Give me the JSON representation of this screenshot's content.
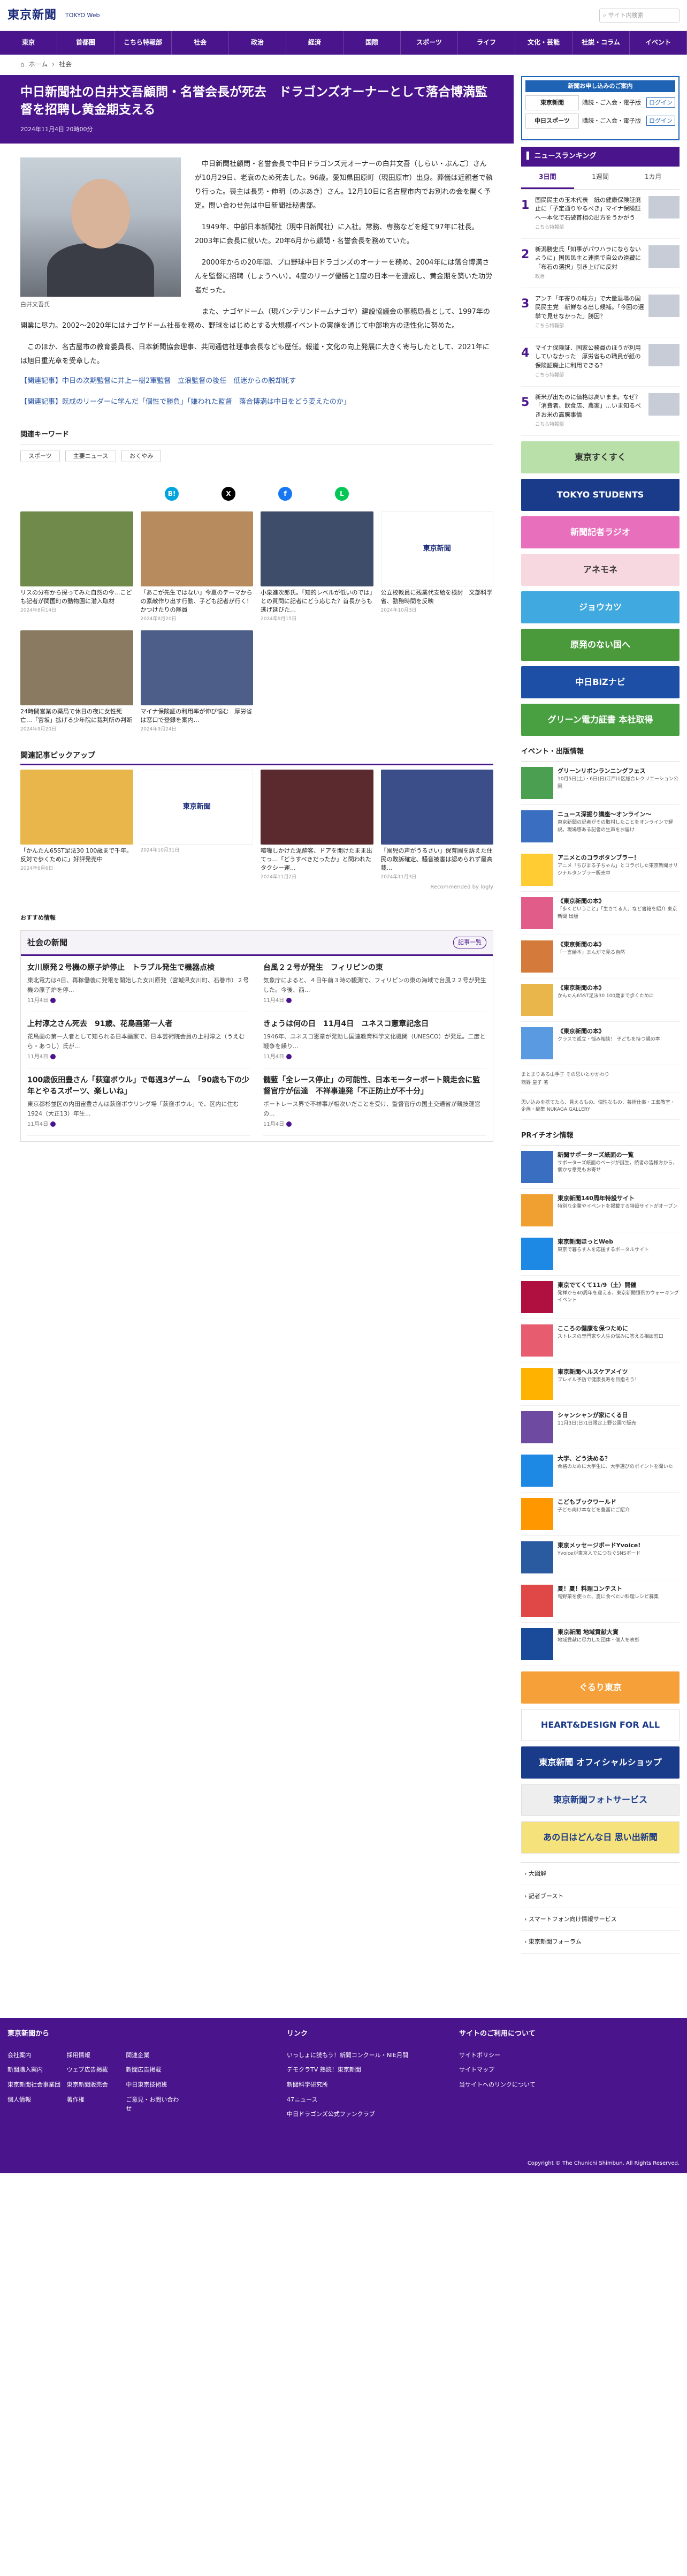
{
  "site": {
    "logo": "東京新聞",
    "logo_sub": "TOKYO Web",
    "search_placeholder": "サイト内検索"
  },
  "nav": [
    "東京",
    "首都圏",
    "こちら特報部",
    "社会",
    "政治",
    "経済",
    "国際",
    "スポーツ",
    "ライフ",
    "文化・芸能",
    "社説・コラム",
    "イベント"
  ],
  "breadcrumb": [
    "ホーム",
    "社会"
  ],
  "article": {
    "title": "中日新聞社の白井文吾顧問・名誉会長が死去　ドラゴンズオーナーとして落合博満監督を招聘し黄金期支える",
    "date": "2024年11月4日 20時00分",
    "caption": "白井文吾氏",
    "paragraphs": [
      "中日新聞社顧問・名誉会長で中日ドラゴンズ元オーナーの白井文吾（しらい・ぶんご）さんが10月29日、老衰のため死去した。96歳。愛知県田原町（現田原市）出身。葬儀は近親者で執り行った。喪主は長男・伸明（のぶあき）さん。12月10日に名古屋市内でお別れの会を開く予定。問い合わせ先は中日新聞社秘書部。",
      "1949年、中部日本新聞社（現中日新聞社）に入社。常務、専務などを経て97年に社長。2003年に会長に就いた。20年6月から顧問・名誉会長を務めていた。",
      "2000年からの20年間、プロ野球中日ドラゴンズのオーナーを務め、2004年には落合博満さんを監督に招聘（しょうへい）。4度のリーグ優勝と1度の日本一を達成し、黄金期を築いた功労者だった。",
      "また、ナゴヤドーム（現バンテリンドームナゴヤ）建設協議会の事務局長として、1997年の開業に尽力。2002〜2020年にはナゴヤドーム社長を務め、野球をはじめとする大規模イベントの実施を通じて中部地方の活性化に努めた。",
      "このほか、名古屋市の教育委員長、日本新聞協会理事、共同通信社理事会長なども歴任。報道・文化の向上発展に大きく寄与したとして、2021年には旭日重光章を受章した。"
    ],
    "related": [
      "【関連記事】中日の次期監督に井上一樹2軍監督　立浪監督の後任　低迷からの脱却託す",
      "【関連記事】既成のリーダーに学んだ「個性で勝負」「嫌われた監督　落合博満は中日をどう変えたのか」"
    ]
  },
  "keywords": {
    "title": "関連キーワード",
    "items": [
      "スポーツ",
      "主要ニュース",
      "おくやみ"
    ]
  },
  "share": [
    {
      "icon": "hatena-icon",
      "label": "B!",
      "color": "#00a4de"
    },
    {
      "icon": "x-icon",
      "label": "X",
      "color": "#000000"
    },
    {
      "icon": "facebook-icon",
      "label": "f",
      "color": "#1877f2"
    },
    {
      "icon": "line-icon",
      "label": "L",
      "color": "#06c755"
    }
  ],
  "cards": [
    {
      "title": "リスの分布から探ってみた自然の今…こども記者が関国町の動物園に潜入取材",
      "date": "2024年8月14日",
      "color": "#6f8a4a"
    },
    {
      "title": "「あこが先生ではない」今夏のテーマからの素敵作り出す行動、子ども記者が行く！かつけたりの隊員",
      "date": "2024年8月20日",
      "color": "#b78b5d"
    },
    {
      "title": "小泉進次郎氏。「知的レベルが低いのでは」との質問に記者にどう応じた？首長からも逃げ延びた…",
      "date": "2024年9月15日",
      "color": "#3e4e6a"
    },
    {
      "title": "公立校教員に残業代支給を検討　文部科学省、勤務時間を反映",
      "date": "2024年10月3日",
      "color": "#ffffff"
    },
    {
      "title": "24時間営業の薬局で休日の夜に女性死亡…「宮坂」拡げる少年院に裁判所の判断",
      "date": "2024年9月20日",
      "color": "#8a7a62"
    },
    {
      "title": "マイナ保険証の利用率が伸び悩む　厚労省は窓口で登録を案内…",
      "date": "2024年9月24日",
      "color": "#4d5f88"
    }
  ],
  "pickup": {
    "title": "関連記事ピックアップ",
    "items": [
      {
        "title": "「かんたん65ST足法30 100歳まで千年。反対で歩くために」好評発売中",
        "date": "2024年6月6日",
        "color": "#e8b64a"
      },
      {
        "title": "",
        "date": "2024年10月31日",
        "color": "#ffffff"
      },
      {
        "title": "喧嘩しかけた泥酔客、ドアを開けたまま出てっ…「どうすべきだったか」と問われたタクシー運...",
        "date": "2024年11月2日",
        "color": "#5a2a2e"
      },
      {
        "title": "「園児の声がうるさい」保育園を訴えた住民の敗訴確定、騒音被害は認められず最高裁...",
        "date": "2024年11月3日",
        "color": "#3c4e8a"
      }
    ],
    "rec": "Recommended by logly"
  },
  "osusume": "おすすめ情報",
  "society": {
    "title": "社会の新聞",
    "more": "記事一覧",
    "items": [
      {
        "title": "女川原発２号機の原子炉停止　トラブル発生で機器点検",
        "summary": "東北電力は4日、再稼働後に発電を開始した女川原発（宮城県女川町、石巻市）２号機の原子炉を停...",
        "date": "11月4日"
      },
      {
        "title": "台風２２号が発生　フィリピンの東",
        "summary": "気象庁によると、４日午前３時の観測で、フィリピンの東の海域で台風２２号が発生した。今後、西...",
        "date": "11月4日"
      },
      {
        "title": "上村淳之さん死去　91歳、花鳥画第一人者",
        "summary": "花鳥画の第一人者として知られる日本画家で、日本芸術院会員の上村淳之（うえむら・あつし）氏が...",
        "date": "11月4日"
      },
      {
        "title": "きょうは何の日　11月4日　ユネスコ憲章記念日",
        "summary": "1946年、ユネスコ憲章が発効し国連教育科学文化機関（UNESCO）が発足。二度と戦争を繰り...",
        "date": "11月4日"
      },
      {
        "title": "100歳仮田豊さん「荻窪ボウル」で毎週3ゲーム　「90歳も下の少年とやるスポーツ、楽しいね」",
        "summary": "東京都杉並区の内田宙豊さんは荻窪ボウリング場「荻窪ボウル」で、区内に住む1924（大正13）年生...",
        "date": "11月4日"
      },
      {
        "title": "髄藍「全レース停止」の可能性、日本モーターボート競走会に監督官庁が伝達　不祥事連発「不正防止が不十分」",
        "summary": "ボートレース界で不祥事が相次いだことを受け、監督官庁の国土交通省が競技運営の...",
        "date": "11月4日"
      }
    ]
  },
  "side": {
    "promo": {
      "title": "新聞お申し込みのご案内",
      "rows": [
        {
          "logo": "東京新聞",
          "items": "購読・ご入会・電子版",
          "btn": "ログイン"
        },
        {
          "logo": "中日スポーツ",
          "items": "購読・ご入会・電子版",
          "btn": "ログイン"
        }
      ]
    },
    "ranking": {
      "title": "ニュースランキング",
      "tabs": [
        "3日間",
        "1週間",
        "1カ月"
      ],
      "items": [
        {
          "num": "1",
          "title": "国民民主の玉木代表　紙の健康保険証廃止に「予定通りやるべき」マイナ保険証へ一本化で石破首相の出方をうかがう",
          "src": "こちら特報部"
        },
        {
          "num": "2",
          "title": "新潟勝史氏「知事がパワハラにならないように」国民民主と連携で自公の遠藏に「布石の選択」引き上げに反対",
          "src": "政治"
        },
        {
          "num": "3",
          "title": "アンチ「年寄りの味方」で大量退場の国民民主党　新鮮なる出し候補。「今回の選挙で見せなかった」勝因？",
          "src": "こちら特報部"
        },
        {
          "num": "4",
          "title": "マイナ保険証、国家公務員のほうが利用していなかった　厚労省もの職員が紙の保険証廃止に利用できる？",
          "src": "こちら特報部"
        },
        {
          "num": "5",
          "title": "新米が出たのに価格は高いまま。なぜ？「消費者、飲食店、農家」…いま知るべきお米の高騰事情",
          "src": "こちら特報部"
        }
      ]
    },
    "banners": [
      {
        "label": "東京すくすく",
        "color": "#b8e0a8"
      },
      {
        "label": "TOKYO STUDENTS",
        "color": "#1a3a8a"
      },
      {
        "label": "新聞記者ラジオ",
        "color": "#e86fbc"
      },
      {
        "label": "アネモネ",
        "color": "#f7d8e0"
      },
      {
        "label": "ジョウカツ",
        "color": "#3fa9e0"
      },
      {
        "label": "原発のない国へ",
        "color": "#4a9a3c"
      },
      {
        "label": "中日BiZナビ",
        "color": "#1d4fa6"
      },
      {
        "label": "グリーン電力証書 本社取得",
        "color": "#48a040"
      }
    ],
    "events": {
      "title": "イベント・出版情報",
      "items": [
        {
          "title": "グリーンリボンランニングフェス",
          "summary": "10月5日(土)・6日(日)江戸川区総合レクリエーション公園",
          "color": "#4aa050"
        },
        {
          "title": "ニュース深掘り講座〜オンライン〜",
          "summary": "東京新聞の記者がその取材したことをオンラインで解説。現場感ある記者の生声をお届け",
          "color": "#3a6ec0"
        },
        {
          "title": "アニメとのコラボタンブラー！",
          "summary": "アニメ「ちびまる子ちゃん」とコラボした東京新聞オリジナルタンブラー販売中",
          "color": "#ffcc33"
        },
        {
          "title": "《東京新聞の本》",
          "summary": "「歩くということ」「生きてる人」など書籍を紹介 東京新聞 出版",
          "color": "#e25c8a"
        },
        {
          "title": "《東京新聞の本》",
          "summary": "「一言絵本」まんがで見る自然",
          "color": "#d47a3a"
        },
        {
          "title": "《東京新聞の本》",
          "summary": "かんたん65ST足法30 100歳まで歩くために",
          "color": "#e8b64a"
        },
        {
          "title": "《東京新聞の本》",
          "summary": "クラスで孤立・悩み相談！ 子どもを持つ親の本",
          "color": "#5a9ae0"
        }
      ]
    },
    "misc": [
      "まとまりある山手子 その思いとかかわり",
      "西野 皇子 著",
      "思い込みを捨てたら、見えるもの。個性なもの、芸術仕事・工藝教室・企画・編集 NUKAGA GALLERY"
    ],
    "pr": {
      "title": "PRイチオシ情報",
      "items": [
        {
          "title": "新聞サポーターズ紙面の一覧",
          "summary": "サポーターズ紙面のページが誕生。読者の皆様方から、個かな意見もお寄せ",
          "color": "#3a6ec0"
        },
        {
          "title": "東京新聞140周年特設サイト",
          "summary": "特別な企業やイベントを掲載する特設サイトがオープン",
          "color": "#f0a030"
        },
        {
          "title": "東京新聞ほっとWeb",
          "summary": "東京で暮らす人を応援するポータルサイト",
          "color": "#1e88e5"
        },
        {
          "title": "東京でてくて11/9（土）開催",
          "summary": "発祥から40周年を迎える、東京新聞恒例のウォーキングイベント",
          "color": "#b01040"
        },
        {
          "title": "こころの健康を保つために",
          "summary": "ストレスの専門家や人生の悩みに答える相談窓口",
          "color": "#e85c70"
        },
        {
          "title": "東京新聞ヘルスケアメイツ",
          "summary": "プレイル予防で健康長寿を目指そう！",
          "color": "#ffb300"
        },
        {
          "title": "シャンシャンが家にくる日",
          "summary": "11月3日(日)1日限定上野公園で販売",
          "color": "#6e4aa0"
        },
        {
          "title": "大学、どう決める？",
          "summary": "合格のために大学生に、大学選びのポイントを聞いた",
          "color": "#1e88e5"
        },
        {
          "title": "こどもブックワールド",
          "summary": "子ども向け本などを豊富にご紹介",
          "color": "#ff9800"
        },
        {
          "title": "東京メッセージボードYvoice!",
          "summary": "Yvoiceが東京人でにつなぐSNSボード",
          "color": "#2a5aa0"
        },
        {
          "title": "夏！夏！料理コンテスト",
          "summary": "旬野菜を使った、夏に食べたい料理レシピ募集",
          "color": "#e04848"
        },
        {
          "title": "東京新聞 地域貢献大賞",
          "summary": "地域貢献に尽力した団体・個人を表彰",
          "color": "#1a4a9a"
        }
      ]
    },
    "banners2": [
      {
        "label": "ぐるり東京",
        "color": "#f6a03a"
      },
      {
        "label": "HEART&DESIGN FOR ALL",
        "color": "#ffffff"
      },
      {
        "label": "東京新聞 オフィシャルショップ",
        "color": "#1a3a8a"
      },
      {
        "label": "東京新聞フォトサービス",
        "color": "#eeeeee"
      },
      {
        "label": "あの日はどんな日 思い出新聞",
        "color": "#f6e27a"
      }
    ],
    "links": [
      "大図解",
      "記者ブースト",
      "スマートフォン向け情報サービス",
      "東京新聞フォーラム"
    ]
  },
  "footer": {
    "col1": {
      "title": "東京新聞から",
      "items": [
        "会社案内",
        "採用情報",
        "関連企業",
        "新聞購入案内",
        "ウェブ広告掲載",
        "新聞広告掲載",
        "東京新聞社会事業団",
        "東京新聞販売会",
        "中日東京技術班",
        "個人情報",
        "著作権",
        "ご意見・お問い合わせ"
      ]
    },
    "col2": {
      "title": "リンク",
      "items": [
        "いっしょに読もう！新聞コンクール・NIE月間",
        "デモクラTV 熟読！東京新聞",
        "新聞科学研究所",
        "47ニュース",
        "中日ドラゴンズ公式ファンクラブ"
      ]
    },
    "col3": {
      "title": "サイトのご利用について",
      "items": [
        "サイトポリシー",
        "サイトマップ",
        "当サイトへのリンクについて"
      ]
    },
    "copy": "Copyright © The Chunichi Shimbun, All Rights Reserved."
  }
}
